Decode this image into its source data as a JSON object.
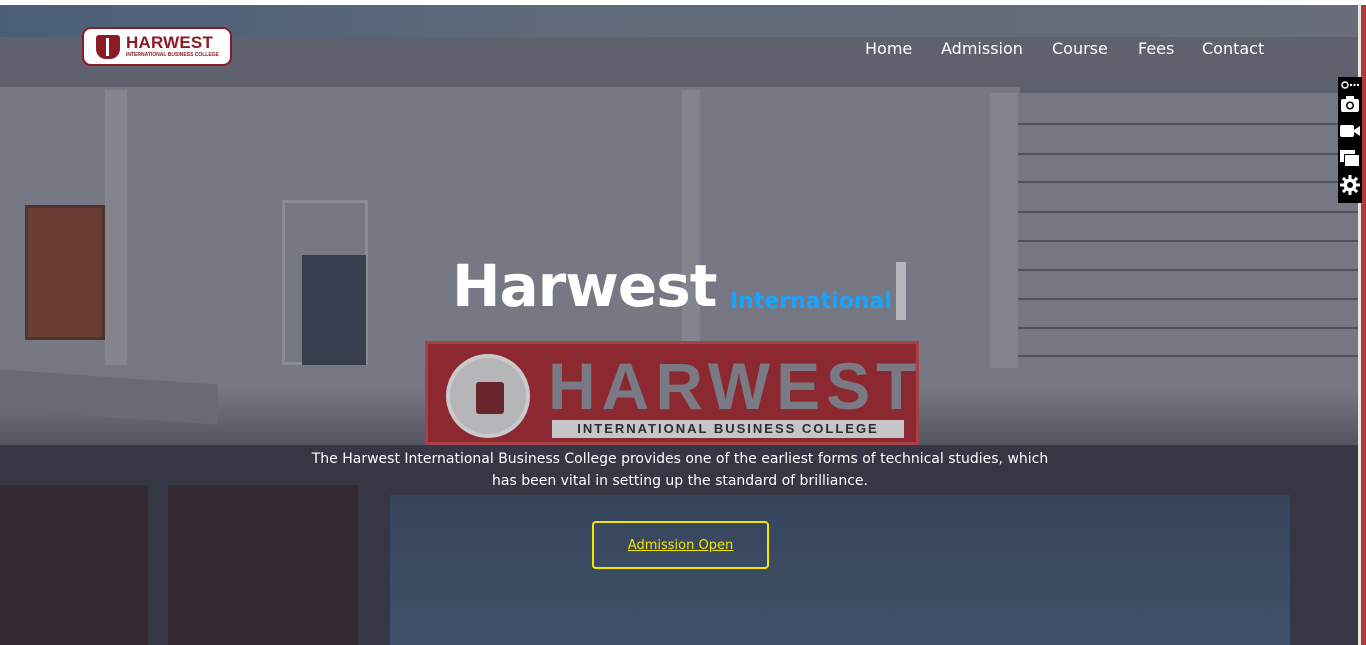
{
  "brand": {
    "name": "HARWEST",
    "tagline": "INTERNATIONAL BUSINESS COLLEGE",
    "color": "#8c1c24"
  },
  "nav": {
    "items": [
      {
        "label": "Home"
      },
      {
        "label": "Admission"
      },
      {
        "label": "Course"
      },
      {
        "label": "Fees"
      },
      {
        "label": "Contact"
      }
    ]
  },
  "hero": {
    "title": "Harwest",
    "title_accent": "International",
    "accent_color": "#1aa3ff",
    "description": "The Harwest International Business College provides one of the earliest forms of technical studies, which has been vital in setting up the standard of brilliance.",
    "cta_label": "Admission Open",
    "cta_color": "#f2e600",
    "sign_word": "HARWEST",
    "sign_subtitle": "INTERNATIONAL BUSINESS COLLEGE"
  },
  "toolbar": {
    "icons": [
      "more-icon",
      "camera-icon",
      "video-icon",
      "windows-icon",
      "gear-icon"
    ]
  }
}
